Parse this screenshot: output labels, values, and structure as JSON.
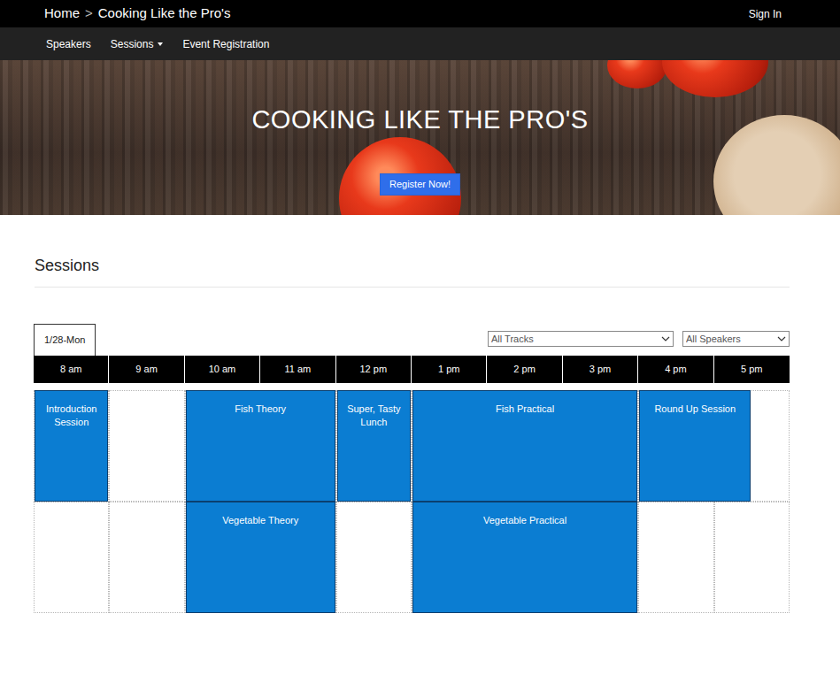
{
  "breadcrumb": {
    "home": "Home",
    "separator": ">",
    "current": "Cooking Like the Pro's"
  },
  "account": {
    "sign_in": "Sign In"
  },
  "nav": [
    {
      "label": "Speakers",
      "dropdown": false
    },
    {
      "label": "Sessions",
      "dropdown": true
    },
    {
      "label": "Event Registration",
      "dropdown": false
    }
  ],
  "hero": {
    "title": "COOKING LIKE THE PRO'S",
    "button": "Register Now!"
  },
  "section": {
    "title": "Sessions"
  },
  "schedule": {
    "days": [
      {
        "label": "1/28-Mon",
        "selected": true
      }
    ],
    "filters": {
      "track": "All Tracks",
      "speaker": "All Speakers"
    },
    "times": [
      "8 am",
      "9 am",
      "10 am",
      "11 am",
      "12 pm",
      "1 pm",
      "2 pm",
      "3 pm",
      "4 pm",
      "5 pm"
    ],
    "rows": [
      {
        "sessions": [
          {
            "title": "Introduction Session"
          },
          {
            "title": "Fish Theory"
          },
          {
            "title": "Super, Tasty Lunch"
          },
          {
            "title": "Fish Practical"
          },
          {
            "title": "Round Up Session"
          }
        ]
      },
      {
        "sessions": [
          {
            "title": "Vegetable Theory"
          },
          {
            "title": "Vegetable Practical"
          }
        ]
      }
    ]
  }
}
